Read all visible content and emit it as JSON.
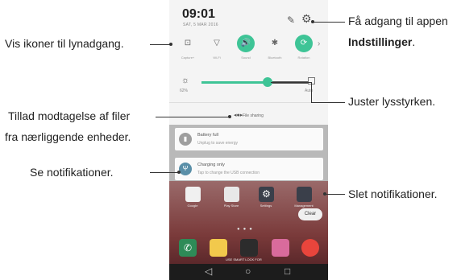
{
  "status": {
    "time": "09:01",
    "date": "SAT, 5 MAR 2016"
  },
  "quick_settings": [
    {
      "label": "Capture+",
      "icon": "capture-icon",
      "glyph": "⊡",
      "on": false
    },
    {
      "label": "Wi-Fi",
      "icon": "wifi-icon",
      "glyph": "▽",
      "on": false
    },
    {
      "label": "Sound",
      "icon": "sound-icon",
      "glyph": "🔊",
      "on": true
    },
    {
      "label": "Bluetooth",
      "icon": "bluetooth-icon",
      "glyph": "✱",
      "on": false
    },
    {
      "label": "Rotation",
      "icon": "rotation-icon",
      "glyph": "⟳",
      "on": true
    }
  ],
  "brightness": {
    "percent_label": "62%",
    "level": 0.62,
    "auto_label": "Auto"
  },
  "file_sharing": {
    "label": "File sharing"
  },
  "notifications": [
    {
      "title": "Battery full",
      "subtitle": "Unplug to save energy",
      "icon": "battery-icon",
      "color": "#9e9e9e"
    },
    {
      "title": "Charging only",
      "subtitle": "Tap to change the USB connection",
      "icon": "usb-icon",
      "color": "#5a8fa8"
    }
  ],
  "home": {
    "apps": [
      {
        "label": "Google",
        "color": "#f0f0f0"
      },
      {
        "label": "Play Store",
        "color": "#e8e8e8"
      },
      {
        "label": "Settings",
        "color": "#3a3f4a"
      },
      {
        "label": "Management",
        "color": "#3a3f4a"
      }
    ],
    "clear_label": "Clear",
    "dock": [
      {
        "name": "phone-app",
        "color": "#2e8b57"
      },
      {
        "name": "messages-app",
        "color": "#f2c94c"
      },
      {
        "name": "camera-app",
        "color": "#2c2c2c"
      },
      {
        "name": "gallery-app",
        "color": "#d96b9c"
      },
      {
        "name": "chrome-app",
        "color": "#e8453c"
      }
    ],
    "lock_hint": "USE SMART LOCK FOR"
  },
  "nav": {
    "back": "◁",
    "home": "○",
    "recents": "□"
  },
  "callouts": {
    "settings_line1": "Få adgang til appen",
    "settings_line2": "Indstillinger",
    "settings_period": ".",
    "quick_access": "Vis ikoner til lynadgang.",
    "brightness": "Juster lysstyrken.",
    "file_sharing_line1": "Tillad modtagelse af filer",
    "file_sharing_line2": "fra nærliggende enheder.",
    "notifications": "Se notifikationer.",
    "clear": "Slet notifikationer."
  },
  "colors": {
    "accent": "#3ec496"
  }
}
